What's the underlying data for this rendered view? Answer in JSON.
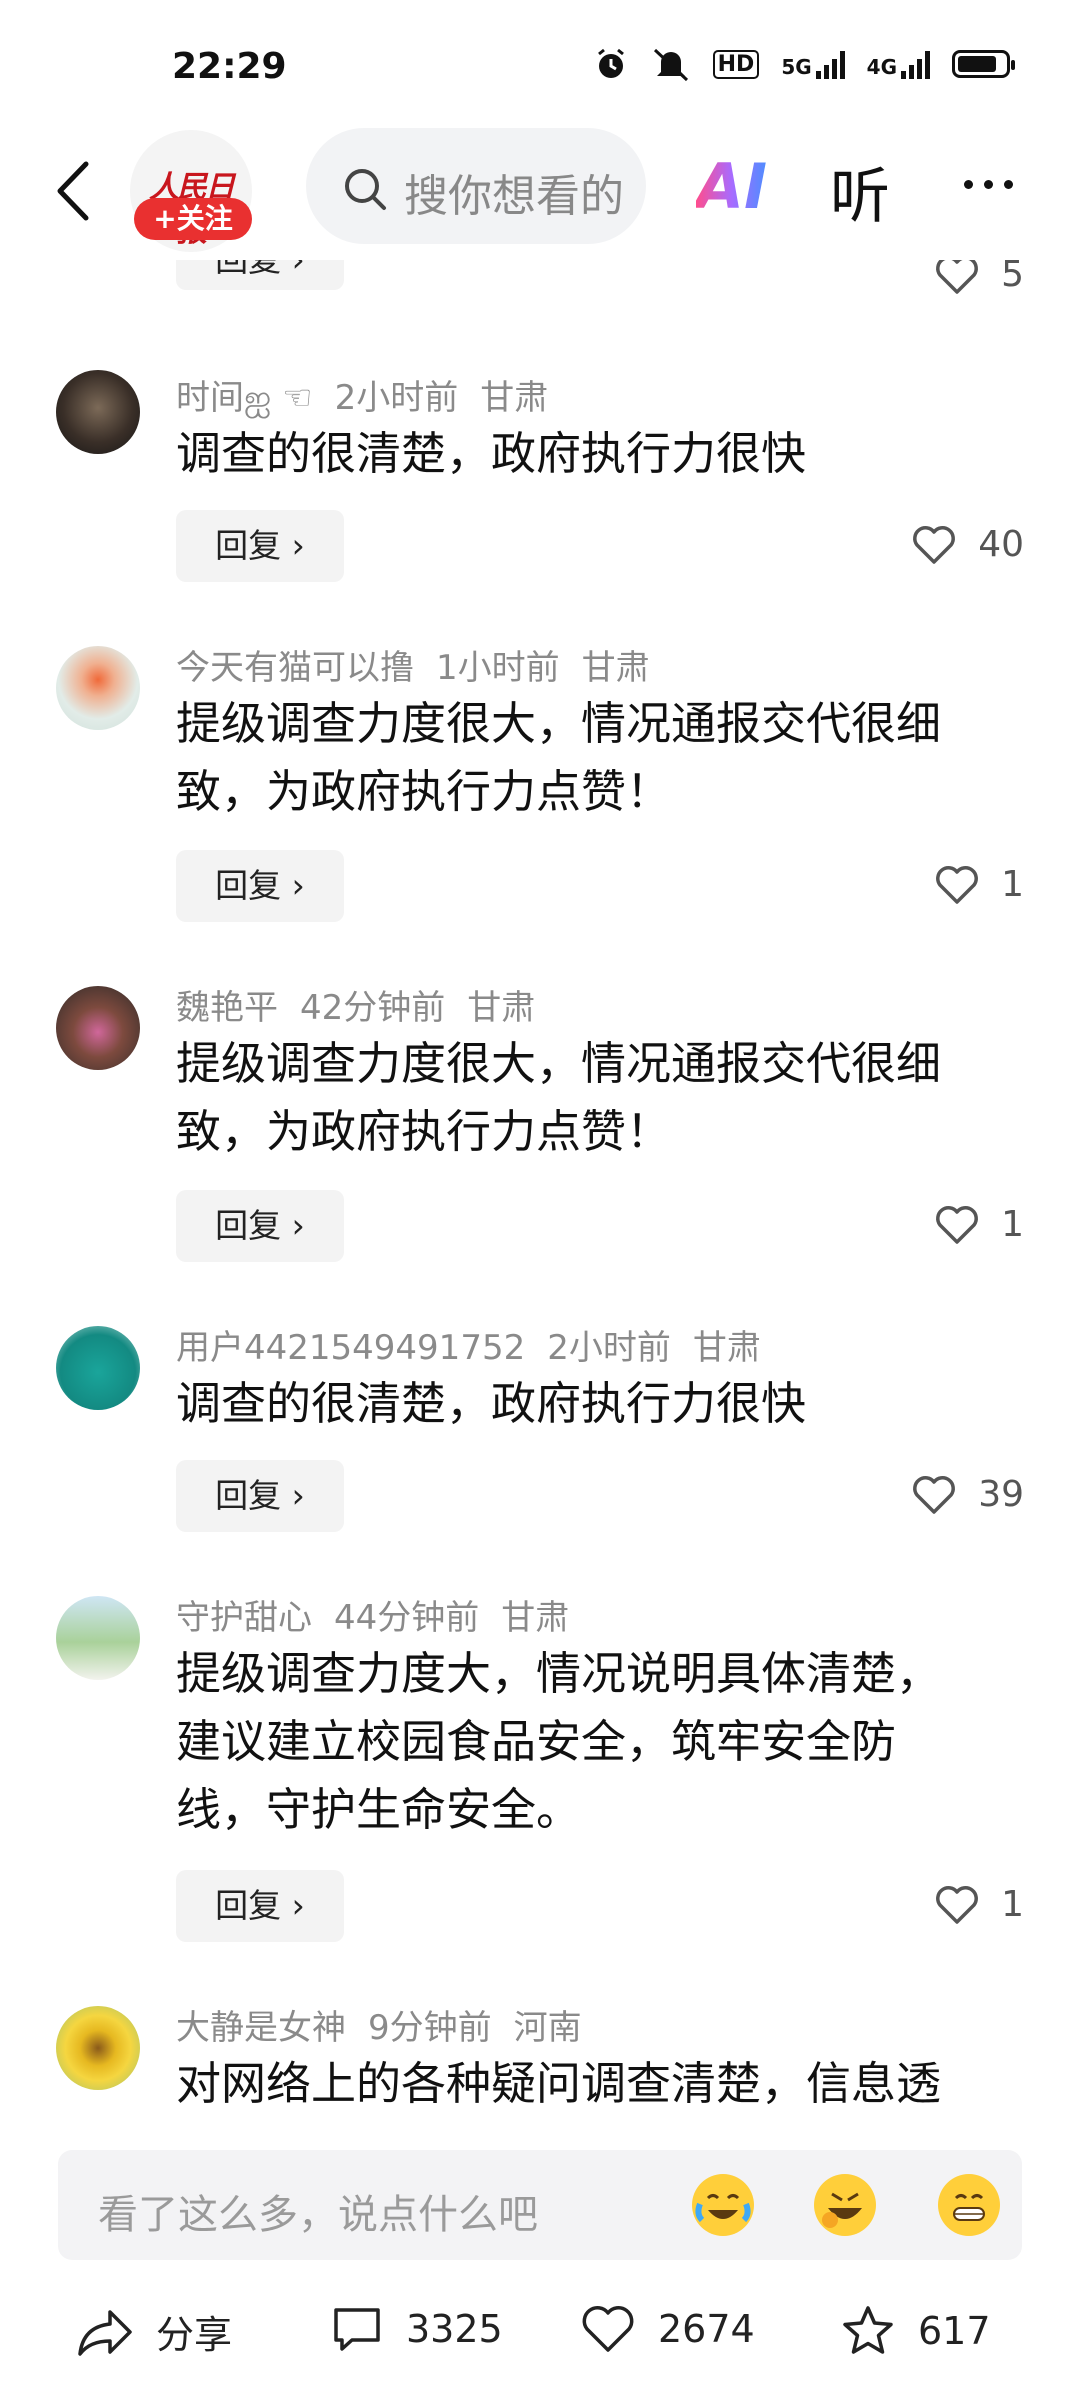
{
  "status_bar": {
    "time": "22:29",
    "net1": "5G",
    "net2": "4G",
    "hd": "HD"
  },
  "header": {
    "logo_text": "人民日报",
    "follow_label": "+关注",
    "search_placeholder": "搜你想看的",
    "ai_label": "AI",
    "listen_label": "听"
  },
  "partial_top": {
    "reply_label": "回复 ›",
    "likes": "5"
  },
  "comments": [
    {
      "user": "时间ஐ ☜",
      "time": "2小时前",
      "location": "甘肃",
      "text": "调查的很清楚，政府执行力很快",
      "reply_label": "回复 ›",
      "likes": "40"
    },
    {
      "user": "今天有猫可以撸",
      "time": "1小时前",
      "location": "甘肃",
      "text": "提级调查力度很大，情况通报交代很细致，为政府执行力点赞！",
      "reply_label": "回复 ›",
      "likes": "1"
    },
    {
      "user": "魏艳平",
      "time": "42分钟前",
      "location": "甘肃",
      "text": "提级调查力度很大，情况通报交代很细致，为政府执行力点赞！",
      "reply_label": "回复 ›",
      "likes": "1"
    },
    {
      "user": "用户4421549491752",
      "time": "2小时前",
      "location": "甘肃",
      "text": "调查的很清楚，政府执行力很快",
      "reply_label": "回复 ›",
      "likes": "39"
    },
    {
      "user": "守护甜心",
      "time": "44分钟前",
      "location": "甘肃",
      "text": "提级调查力度大，情况说明具体清楚，建议建立校园食品安全，筑牢安全防线，守护生命安全。",
      "reply_label": "回复 ›",
      "likes": "1"
    },
    {
      "user": "大静是女神",
      "time": "9分钟前",
      "location": "河南",
      "text": "对网络上的各种疑问调查清楚，信息透"
    }
  ],
  "input_bar": {
    "placeholder": "看了这么多，说点什么吧",
    "emojis": [
      "crying-laughing-emoji",
      "rolling-laughing-emoji",
      "grinning-emoji"
    ]
  },
  "bottom_bar": {
    "share_label": "分享",
    "comments_count": "3325",
    "likes_count": "2674",
    "favorites_count": "617"
  },
  "colors": {
    "accent_red": "#e93030",
    "logo_red": "#c8161d",
    "meta_gray": "#8a8a8a"
  }
}
